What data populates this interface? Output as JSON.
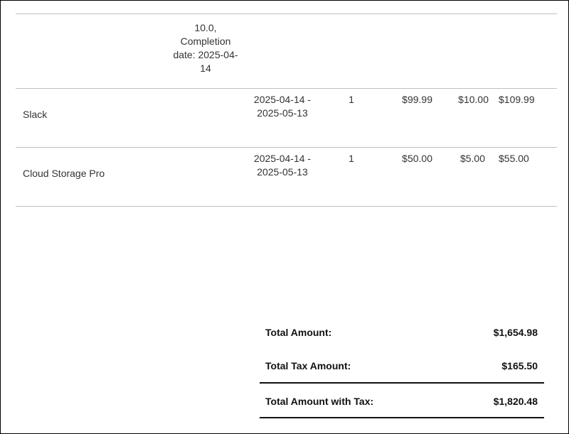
{
  "partial_row": {
    "lines": [
      "10.0,",
      "Completion",
      "date: 2025-04-",
      "14"
    ]
  },
  "items": [
    {
      "name": "Slack",
      "period_start": "2025-04-14 -",
      "period_end": "2025-05-13",
      "quantity": "1",
      "price": "$99.99",
      "tax": "$10.00",
      "total": "$109.99"
    },
    {
      "name": "Cloud Storage Pro",
      "period_start": "2025-04-14 -",
      "period_end": "2025-05-13",
      "quantity": "1",
      "price": "$50.00",
      "tax": "$5.00",
      "total": "$55.00"
    }
  ],
  "totals": {
    "total_amount_label": "Total Amount:",
    "total_amount_value": "$1,654.98",
    "total_tax_label": "Total Tax Amount:",
    "total_tax_value": "$165.50",
    "total_with_tax_label": "Total Amount with Tax:",
    "total_with_tax_value": "$1,820.48"
  }
}
